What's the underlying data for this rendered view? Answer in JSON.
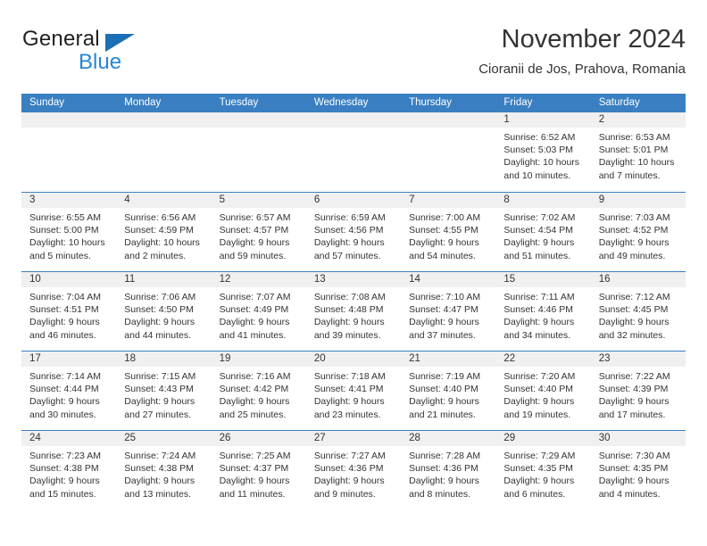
{
  "brand": {
    "name_top": "General",
    "name_bottom": "Blue",
    "accent_color": "#2787d6",
    "triangle_color": "#1a6fb5"
  },
  "header": {
    "title": "November 2024",
    "location": "Cioranii de Jos, Prahova, Romania"
  },
  "calendar": {
    "header_color": "#3a7fc1",
    "day_band_color": "#f0f0f0",
    "weekdays": [
      "Sunday",
      "Monday",
      "Tuesday",
      "Wednesday",
      "Thursday",
      "Friday",
      "Saturday"
    ],
    "weeks": [
      [
        {
          "day": "",
          "empty": true
        },
        {
          "day": "",
          "empty": true
        },
        {
          "day": "",
          "empty": true
        },
        {
          "day": "",
          "empty": true
        },
        {
          "day": "",
          "empty": true
        },
        {
          "day": "1",
          "sunrise": "Sunrise: 6:52 AM",
          "sunset": "Sunset: 5:03 PM",
          "daylight_line1": "Daylight: 10 hours",
          "daylight_line2": "and 10 minutes."
        },
        {
          "day": "2",
          "sunrise": "Sunrise: 6:53 AM",
          "sunset": "Sunset: 5:01 PM",
          "daylight_line1": "Daylight: 10 hours",
          "daylight_line2": "and 7 minutes."
        }
      ],
      [
        {
          "day": "3",
          "sunrise": "Sunrise: 6:55 AM",
          "sunset": "Sunset: 5:00 PM",
          "daylight_line1": "Daylight: 10 hours",
          "daylight_line2": "and 5 minutes."
        },
        {
          "day": "4",
          "sunrise": "Sunrise: 6:56 AM",
          "sunset": "Sunset: 4:59 PM",
          "daylight_line1": "Daylight: 10 hours",
          "daylight_line2": "and 2 minutes."
        },
        {
          "day": "5",
          "sunrise": "Sunrise: 6:57 AM",
          "sunset": "Sunset: 4:57 PM",
          "daylight_line1": "Daylight: 9 hours",
          "daylight_line2": "and 59 minutes."
        },
        {
          "day": "6",
          "sunrise": "Sunrise: 6:59 AM",
          "sunset": "Sunset: 4:56 PM",
          "daylight_line1": "Daylight: 9 hours",
          "daylight_line2": "and 57 minutes."
        },
        {
          "day": "7",
          "sunrise": "Sunrise: 7:00 AM",
          "sunset": "Sunset: 4:55 PM",
          "daylight_line1": "Daylight: 9 hours",
          "daylight_line2": "and 54 minutes."
        },
        {
          "day": "8",
          "sunrise": "Sunrise: 7:02 AM",
          "sunset": "Sunset: 4:54 PM",
          "daylight_line1": "Daylight: 9 hours",
          "daylight_line2": "and 51 minutes."
        },
        {
          "day": "9",
          "sunrise": "Sunrise: 7:03 AM",
          "sunset": "Sunset: 4:52 PM",
          "daylight_line1": "Daylight: 9 hours",
          "daylight_line2": "and 49 minutes."
        }
      ],
      [
        {
          "day": "10",
          "sunrise": "Sunrise: 7:04 AM",
          "sunset": "Sunset: 4:51 PM",
          "daylight_line1": "Daylight: 9 hours",
          "daylight_line2": "and 46 minutes."
        },
        {
          "day": "11",
          "sunrise": "Sunrise: 7:06 AM",
          "sunset": "Sunset: 4:50 PM",
          "daylight_line1": "Daylight: 9 hours",
          "daylight_line2": "and 44 minutes."
        },
        {
          "day": "12",
          "sunrise": "Sunrise: 7:07 AM",
          "sunset": "Sunset: 4:49 PM",
          "daylight_line1": "Daylight: 9 hours",
          "daylight_line2": "and 41 minutes."
        },
        {
          "day": "13",
          "sunrise": "Sunrise: 7:08 AM",
          "sunset": "Sunset: 4:48 PM",
          "daylight_line1": "Daylight: 9 hours",
          "daylight_line2": "and 39 minutes."
        },
        {
          "day": "14",
          "sunrise": "Sunrise: 7:10 AM",
          "sunset": "Sunset: 4:47 PM",
          "daylight_line1": "Daylight: 9 hours",
          "daylight_line2": "and 37 minutes."
        },
        {
          "day": "15",
          "sunrise": "Sunrise: 7:11 AM",
          "sunset": "Sunset: 4:46 PM",
          "daylight_line1": "Daylight: 9 hours",
          "daylight_line2": "and 34 minutes."
        },
        {
          "day": "16",
          "sunrise": "Sunrise: 7:12 AM",
          "sunset": "Sunset: 4:45 PM",
          "daylight_line1": "Daylight: 9 hours",
          "daylight_line2": "and 32 minutes."
        }
      ],
      [
        {
          "day": "17",
          "sunrise": "Sunrise: 7:14 AM",
          "sunset": "Sunset: 4:44 PM",
          "daylight_line1": "Daylight: 9 hours",
          "daylight_line2": "and 30 minutes."
        },
        {
          "day": "18",
          "sunrise": "Sunrise: 7:15 AM",
          "sunset": "Sunset: 4:43 PM",
          "daylight_line1": "Daylight: 9 hours",
          "daylight_line2": "and 27 minutes."
        },
        {
          "day": "19",
          "sunrise": "Sunrise: 7:16 AM",
          "sunset": "Sunset: 4:42 PM",
          "daylight_line1": "Daylight: 9 hours",
          "daylight_line2": "and 25 minutes."
        },
        {
          "day": "20",
          "sunrise": "Sunrise: 7:18 AM",
          "sunset": "Sunset: 4:41 PM",
          "daylight_line1": "Daylight: 9 hours",
          "daylight_line2": "and 23 minutes."
        },
        {
          "day": "21",
          "sunrise": "Sunrise: 7:19 AM",
          "sunset": "Sunset: 4:40 PM",
          "daylight_line1": "Daylight: 9 hours",
          "daylight_line2": "and 21 minutes."
        },
        {
          "day": "22",
          "sunrise": "Sunrise: 7:20 AM",
          "sunset": "Sunset: 4:40 PM",
          "daylight_line1": "Daylight: 9 hours",
          "daylight_line2": "and 19 minutes."
        },
        {
          "day": "23",
          "sunrise": "Sunrise: 7:22 AM",
          "sunset": "Sunset: 4:39 PM",
          "daylight_line1": "Daylight: 9 hours",
          "daylight_line2": "and 17 minutes."
        }
      ],
      [
        {
          "day": "24",
          "sunrise": "Sunrise: 7:23 AM",
          "sunset": "Sunset: 4:38 PM",
          "daylight_line1": "Daylight: 9 hours",
          "daylight_line2": "and 15 minutes."
        },
        {
          "day": "25",
          "sunrise": "Sunrise: 7:24 AM",
          "sunset": "Sunset: 4:38 PM",
          "daylight_line1": "Daylight: 9 hours",
          "daylight_line2": "and 13 minutes."
        },
        {
          "day": "26",
          "sunrise": "Sunrise: 7:25 AM",
          "sunset": "Sunset: 4:37 PM",
          "daylight_line1": "Daylight: 9 hours",
          "daylight_line2": "and 11 minutes."
        },
        {
          "day": "27",
          "sunrise": "Sunrise: 7:27 AM",
          "sunset": "Sunset: 4:36 PM",
          "daylight_line1": "Daylight: 9 hours",
          "daylight_line2": "and 9 minutes."
        },
        {
          "day": "28",
          "sunrise": "Sunrise: 7:28 AM",
          "sunset": "Sunset: 4:36 PM",
          "daylight_line1": "Daylight: 9 hours",
          "daylight_line2": "and 8 minutes."
        },
        {
          "day": "29",
          "sunrise": "Sunrise: 7:29 AM",
          "sunset": "Sunset: 4:35 PM",
          "daylight_line1": "Daylight: 9 hours",
          "daylight_line2": "and 6 minutes."
        },
        {
          "day": "30",
          "sunrise": "Sunrise: 7:30 AM",
          "sunset": "Sunset: 4:35 PM",
          "daylight_line1": "Daylight: 9 hours",
          "daylight_line2": "and 4 minutes."
        }
      ]
    ]
  }
}
